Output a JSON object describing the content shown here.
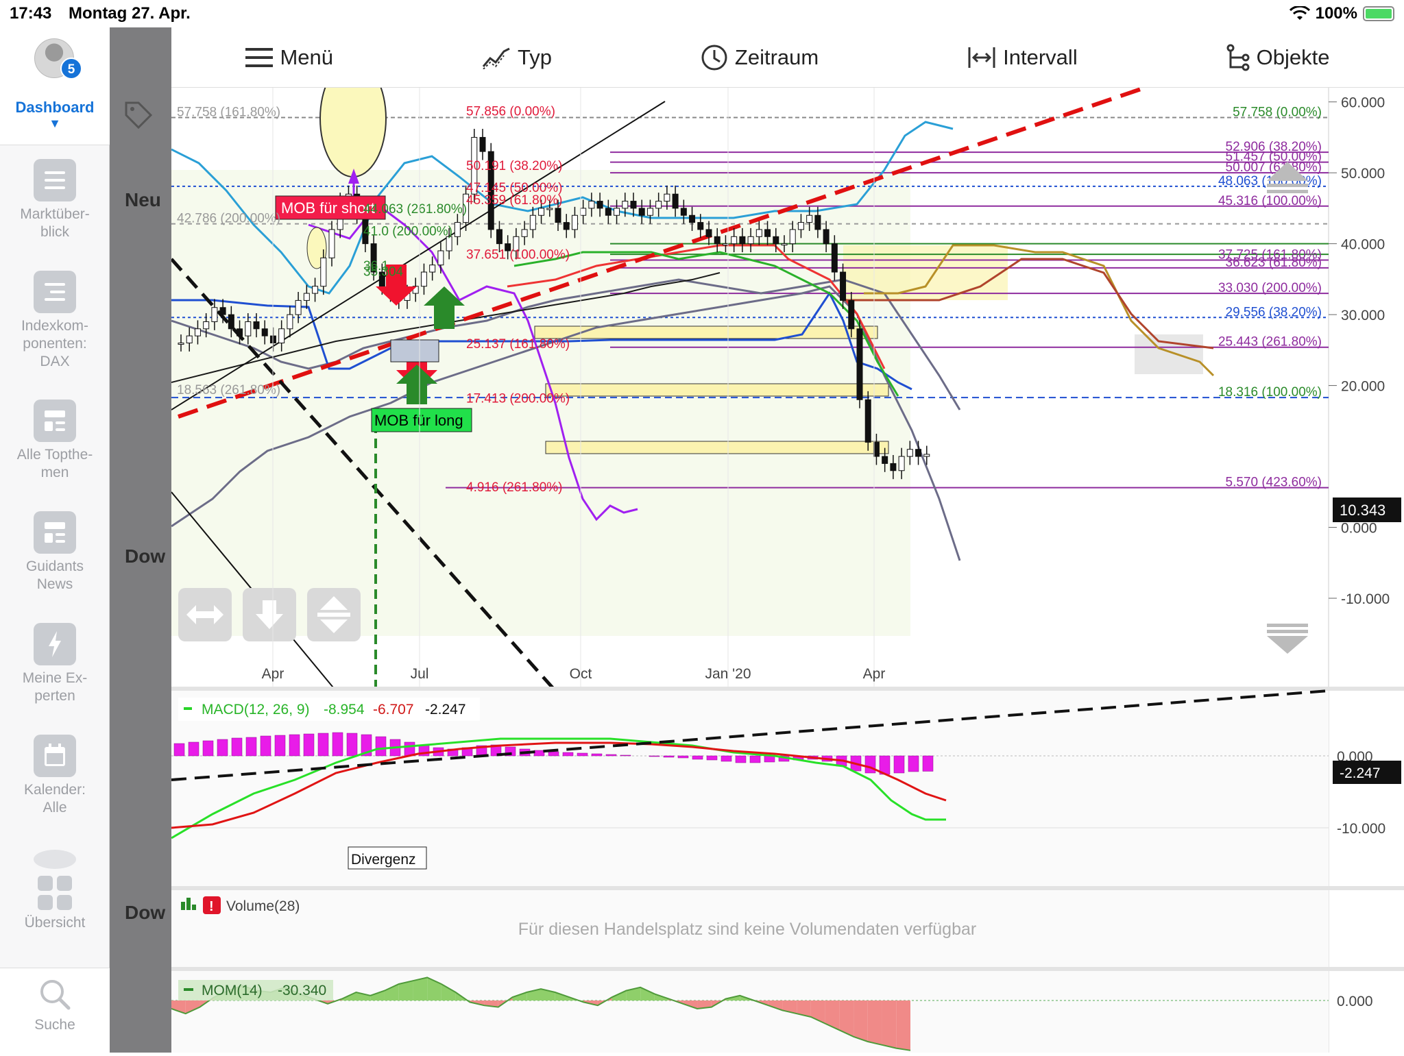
{
  "status": {
    "time": "17:43",
    "date": "Montag 27. Apr.",
    "battery": "100%"
  },
  "sidebar": {
    "badge": "5",
    "dashboard_label": "Dashboard",
    "items": [
      {
        "label": "Marktüber-\nblick",
        "icon": "list-icon"
      },
      {
        "label": "Indexkom-\nponenten:\nDAX",
        "icon": "list-icon"
      },
      {
        "label": "Alle Topthe-\nmen",
        "icon": "newspaper-icon"
      },
      {
        "label": "Guidants\nNews",
        "icon": "newspaper-icon"
      },
      {
        "label": "Meine Ex-\nperten",
        "icon": "lightning-icon"
      },
      {
        "label": "Kalender:\nAlle",
        "icon": "calendar-icon"
      },
      {
        "label": "Übersicht",
        "icon": "grid-icon"
      },
      {
        "label": "Suche",
        "icon": "search-icon"
      }
    ],
    "background_panels": [
      "Neu",
      "Dow",
      "Dow"
    ]
  },
  "toolbar": {
    "menu": "Menü",
    "type": "Typ",
    "period": "Zeitraum",
    "interval": "Intervall",
    "objects": "Objekte"
  },
  "chart_data": [
    {
      "type": "candlestick",
      "x_labels": [
        "Apr",
        "Jul",
        "Oct",
        "Jan '20",
        "Apr"
      ],
      "y_ticks": [
        "60.000",
        "50.000",
        "40.000",
        "30.000",
        "20.000",
        "10.343",
        "0.000",
        "-10.000"
      ],
      "ylim": [
        -10,
        62
      ],
      "current_price": "10.343",
      "fib_labels_left": [
        "57.758 (161.80%)",
        "42.786 (200.00%)",
        "18.563 (261.80%)"
      ],
      "fib_labels_mid": [
        "57.856 (0.00%)",
        "50.191 (38.20%)",
        "47.145 (50.00%)",
        "45.359 (61.80%)",
        "44.063 (261.80%)",
        "41.0 (200.00%)",
        "37.651 (100.00%)",
        "36.1",
        "35.304",
        "25.137 (161.80%)",
        "17.413 (200.00%)",
        "4.916 (261.80%)"
      ],
      "fib_labels_right": [
        "57.758 (0.00%)",
        "52.906 (38.20%)",
        "51.457 (50.00%)",
        "50.007 (61.80%)",
        "48.063 (100.00%)",
        "45.316 (100.00%)",
        "37.725 (161.80%)",
        "36.623 (61.80%)",
        "33.030 (200.00%)",
        "29.556 (38.20%)",
        "25.443 (261.80%)",
        "18.316 (100.00%)",
        "5.570 (423.60%)"
      ],
      "annotations": [
        "MOB für short",
        "MOB für long"
      ],
      "closes": [
        26,
        27,
        28,
        29,
        31,
        30,
        28,
        27,
        29,
        28,
        27,
        26,
        28,
        30,
        32,
        33,
        34,
        38,
        42,
        46,
        47,
        44,
        40,
        36,
        34,
        33,
        32,
        33,
        34,
        36,
        37,
        39,
        41,
        43,
        47,
        55,
        53,
        42,
        40,
        39,
        41,
        42,
        44,
        45,
        45,
        43,
        42,
        44,
        45,
        46,
        45,
        44,
        45,
        46,
        45,
        44,
        45,
        46,
        47,
        45,
        44,
        43,
        42,
        41,
        40,
        40,
        41,
        40,
        41,
        42,
        41,
        40,
        40,
        42,
        43,
        44,
        42,
        40,
        36,
        32,
        28,
        18,
        12,
        10,
        9,
        8,
        10,
        11,
        10,
        10.3
      ]
    },
    {
      "type": "line",
      "title": "MACD(12, 26, 9)",
      "values_shown": [
        "-8.954",
        "-6.707",
        "-2.247"
      ],
      "y_ticks": [
        "0.000",
        "-10.000"
      ],
      "current_value": "-2.247",
      "annotation": "Divergenz",
      "histogram": [
        1.8,
        2.0,
        2.2,
        2.4,
        2.6,
        2.7,
        2.9,
        3.0,
        3.1,
        3.2,
        3.3,
        3.4,
        3.3,
        3.1,
        2.8,
        2.4,
        2.0,
        1.6,
        1.2,
        1.0,
        1.2,
        1.5,
        1.6,
        1.3,
        1.0,
        0.8,
        0.6,
        0.5,
        0.4,
        0.3,
        0.2,
        0.1,
        0.0,
        -0.1,
        -0.2,
        -0.3,
        -0.5,
        -0.6,
        -0.8,
        -1.0,
        -1.0,
        -0.9,
        -0.8,
        -0.6,
        -0.5,
        -0.8,
        -1.5,
        -2.2,
        -2.5,
        -2.7,
        -2.5,
        -2.3,
        -2.247
      ]
    },
    {
      "type": "bar",
      "title": "Volume(28)",
      "message": "Für diesen Handelsplatz sind keine Volumendaten verfügbar"
    },
    {
      "type": "area",
      "title": "MOM(14)",
      "value_shown": "-30.340",
      "y_ticks": [
        "0.000"
      ],
      "values": [
        -5,
        -8,
        -4,
        2,
        6,
        9,
        6,
        5,
        8,
        4,
        1,
        -2,
        1,
        5,
        3,
        6,
        10,
        12,
        14,
        10,
        5,
        -1,
        -3,
        -4,
        2,
        5,
        7,
        5,
        2,
        -1,
        -3,
        2,
        6,
        8,
        4,
        1,
        -2,
        -5,
        -4,
        1,
        3,
        0,
        -3,
        -6,
        -8,
        -10,
        -14,
        -18,
        -22,
        -25,
        -27,
        -29,
        -30.34
      ]
    }
  ]
}
